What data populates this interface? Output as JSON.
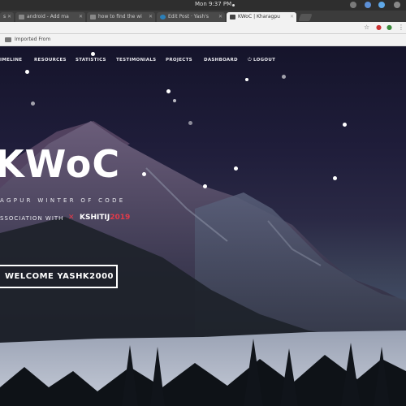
{
  "os": {
    "time": "Mon  9:37 PM"
  },
  "tabs": [
    {
      "label": "s"
    },
    {
      "label": "android - Add ma"
    },
    {
      "label": "how to find the wi"
    },
    {
      "label": "Edit Post · Yash's"
    },
    {
      "label": "KWoC | Kharagpu"
    }
  ],
  "bookmarks": {
    "folder_label": "Imported From"
  },
  "nav": {
    "items": [
      "IMELINE",
      "RESOURCES",
      "STATISTICS",
      "TESTIMONIALS",
      "PROJECTS",
      "DASHBOARD",
      "LOGOUT"
    ]
  },
  "hero": {
    "title": "KWoC",
    "subtitle": "AGPUR WINTER OF CODE",
    "assoc_text": "SSOCIATION WITH",
    "brand_name": "KSHITIJ",
    "brand_year": "2019",
    "welcome_label": "WELCOME YASHK2000"
  },
  "colors": {
    "accent": "#e23a4a",
    "sky_top": "#15142b",
    "sky_mid": "#2a2945"
  }
}
